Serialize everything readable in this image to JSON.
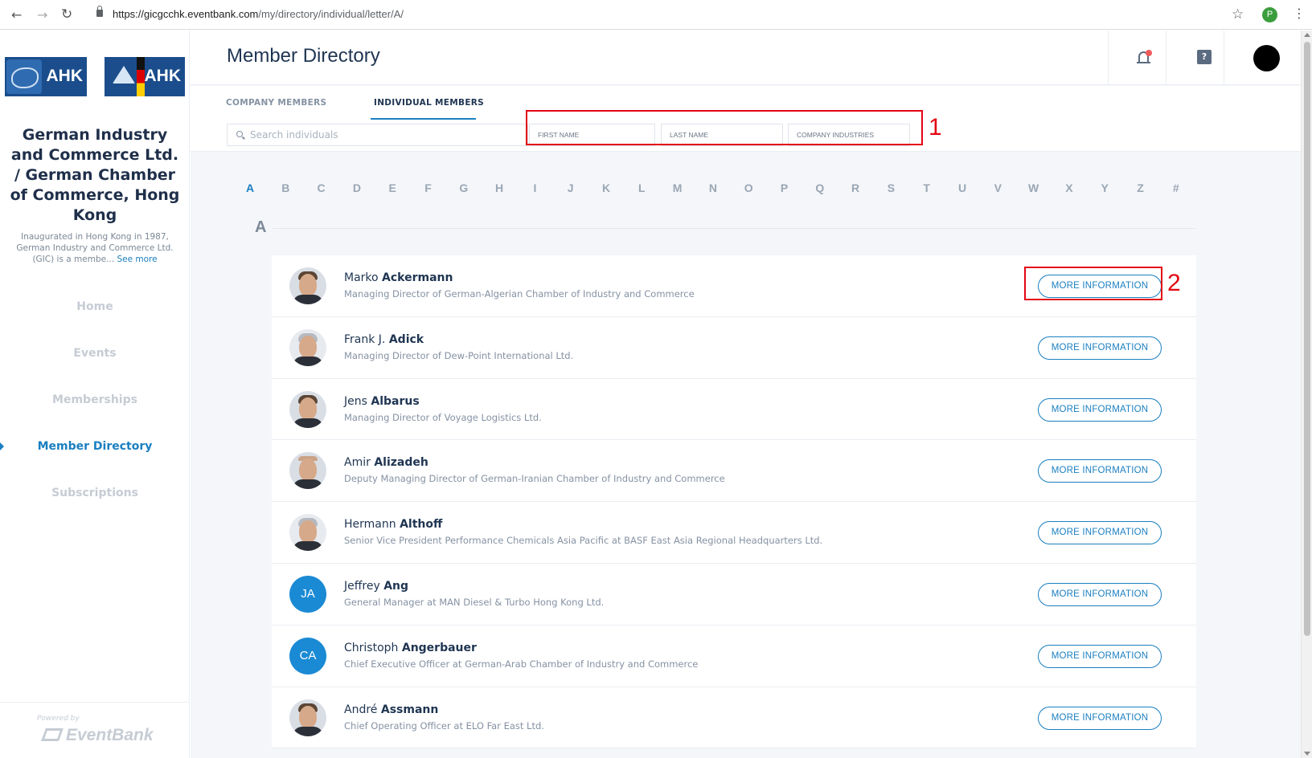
{
  "browser": {
    "url_host": "https://gicgcchk.eventbank.com",
    "url_path": "/my/directory/individual/letter/A/",
    "profile_initial": "P"
  },
  "sidebar": {
    "logo_left_text": "AHK",
    "logo_right_text": "AHK",
    "org_name": "German Industry and Commerce Ltd. / German Chamber of Commerce, Hong Kong",
    "org_description": "Inaugurated in Hong Kong in 1987, German Industry and Commerce Ltd. (GIC) is a membe...",
    "see_more": "See more",
    "nav": [
      {
        "label": "Home",
        "active": false
      },
      {
        "label": "Events",
        "active": false
      },
      {
        "label": "Memberships",
        "active": false
      },
      {
        "label": "Member Directory",
        "active": true
      },
      {
        "label": "Subscriptions",
        "active": false
      }
    ],
    "powered_by": "Powered by",
    "brand": "EventBank"
  },
  "header": {
    "title": "Member Directory"
  },
  "tabs": [
    {
      "label": "COMPANY MEMBERS",
      "active": false
    },
    {
      "label": "INDIVIDUAL MEMBERS",
      "active": true
    }
  ],
  "filters": {
    "search_placeholder": "Search individuals",
    "first_name": "FIRST NAME",
    "last_name": "LAST NAME",
    "company_industries": "COMPANY INDUSTRIES"
  },
  "annotations": {
    "one": "1",
    "two": "2"
  },
  "alphabet": [
    "A",
    "B",
    "C",
    "D",
    "E",
    "F",
    "G",
    "H",
    "I",
    "J",
    "K",
    "L",
    "M",
    "N",
    "O",
    "P",
    "Q",
    "R",
    "S",
    "T",
    "U",
    "V",
    "W",
    "X",
    "Y",
    "Z",
    "#"
  ],
  "active_letter": "A",
  "section_letter": "A",
  "members": [
    {
      "first": "Marko",
      "last": "Ackermann",
      "title": "Managing Director of German-Algerian Chamber of Industry and Commerce",
      "avatar": "photo",
      "initials": ""
    },
    {
      "first": "Frank J.",
      "last": "Adick",
      "title": "Managing Director of Dew-Point International Ltd.",
      "avatar": "photo",
      "initials": ""
    },
    {
      "first": "Jens",
      "last": "Albarus",
      "title": "Managing Director of Voyage Logistics Ltd.",
      "avatar": "photo",
      "initials": ""
    },
    {
      "first": "Amir",
      "last": "Alizadeh",
      "title": "Deputy Managing Director of German-Iranian Chamber of Industry and Commerce",
      "avatar": "photo",
      "initials": ""
    },
    {
      "first": "Hermann",
      "last": "Althoff",
      "title": "Senior Vice President Performance Chemicals Asia Pacific at BASF East Asia Regional Headquarters Ltd.",
      "avatar": "photo",
      "initials": ""
    },
    {
      "first": "Jeffrey",
      "last": "Ang",
      "title": "General Manager at MAN Diesel & Turbo Hong Kong Ltd.",
      "avatar": "initials",
      "initials": "JA"
    },
    {
      "first": "Christoph",
      "last": "Angerbauer",
      "title": "Chief Executive Officer at German-Arab Chamber of Industry and Commerce",
      "avatar": "initials",
      "initials": "CA"
    },
    {
      "first": "André",
      "last": "Assmann",
      "title": "Chief Operating Officer at ELO Far East Ltd.",
      "avatar": "photo",
      "initials": ""
    }
  ],
  "more_info_label": "MORE INFORMATION",
  "colors": {
    "accent": "#1a7fc1",
    "annotation": "#e30613",
    "logo_blue": "#1b4d8c"
  }
}
